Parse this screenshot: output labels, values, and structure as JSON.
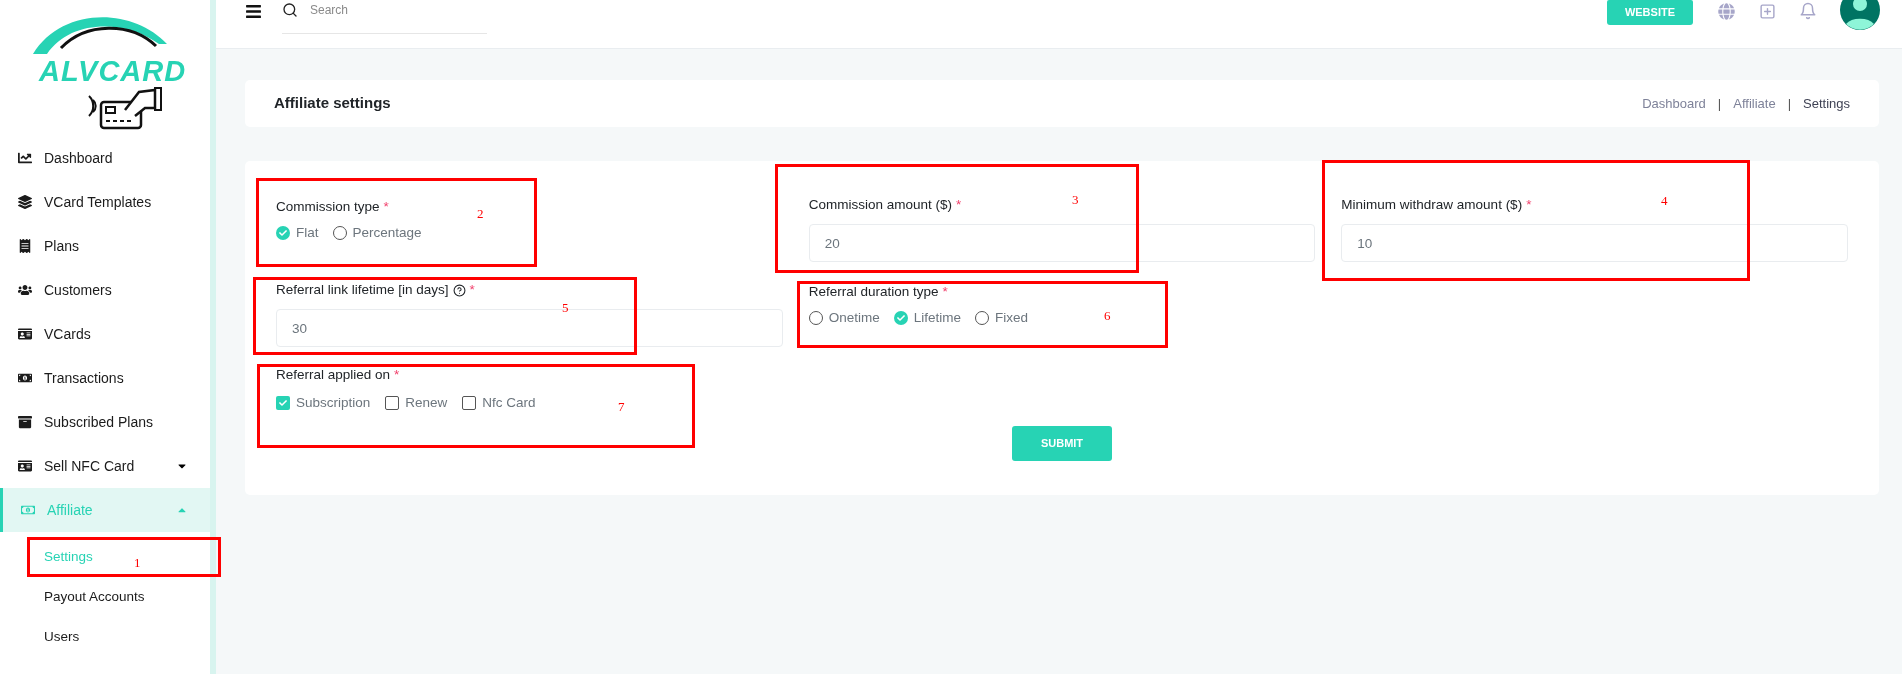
{
  "logo": {
    "text": "ALVCARD"
  },
  "sidebar": {
    "items": [
      {
        "label": "Dashboard",
        "selected": false
      },
      {
        "label": "VCard Templates",
        "selected": false
      },
      {
        "label": "Plans",
        "selected": false
      },
      {
        "label": "Customers",
        "selected": false
      },
      {
        "label": "VCards",
        "selected": false
      },
      {
        "label": "Transactions",
        "selected": false
      },
      {
        "label": "Subscribed Plans",
        "selected": false
      },
      {
        "label": "Sell NFC Card",
        "selected": false,
        "expanded": false
      },
      {
        "label": "Affiliate",
        "selected": true,
        "expanded": true,
        "children": [
          {
            "label": "Settings",
            "selected": true
          },
          {
            "label": "Payout Accounts",
            "selected": false
          },
          {
            "label": "Users",
            "selected": false
          }
        ]
      }
    ]
  },
  "topbar": {
    "search": {
      "placeholder": "Search"
    },
    "button": "WEBSITE"
  },
  "page_header": {
    "title": "Affiliate settings",
    "separator": "|",
    "breadcrumbs": [
      {
        "label": "Dashboard",
        "selected": false
      },
      {
        "label": "Affiliate",
        "selected": false
      },
      {
        "label": "Settings",
        "selected": true
      }
    ]
  },
  "form": {
    "fields": [
      {
        "kind": "radio",
        "label": "Commission type",
        "required": "*",
        "options": [
          {
            "label": "Flat",
            "selected": true
          },
          {
            "label": "Percentage",
            "selected": false
          }
        ]
      },
      {
        "kind": "input",
        "label": "Commission amount ($)",
        "required": "*",
        "value": "20"
      },
      {
        "kind": "input",
        "label": "Minimum withdraw amount ($)",
        "required": "*",
        "value": "10"
      },
      {
        "kind": "input",
        "label": "Referral link lifetime [in days]",
        "help": true,
        "required": "*",
        "value": "30"
      },
      {
        "kind": "radio",
        "label": "Referral duration type",
        "required": "*",
        "options": [
          {
            "label": "Onetime",
            "selected": false
          },
          {
            "label": "Lifetime",
            "selected": true
          },
          {
            "label": "Fixed",
            "selected": false
          }
        ]
      },
      {
        "kind": "empty"
      },
      {
        "kind": "checkbox",
        "label": "Referral applied on",
        "required": "*",
        "options": [
          {
            "label": "Subscription",
            "checked": true
          },
          {
            "label": "Renew",
            "checked": false
          },
          {
            "label": "Nfc Card",
            "checked": false
          }
        ]
      }
    ],
    "submit": "SUBMIT"
  },
  "annotations": [
    {
      "number": "1"
    },
    {
      "number": "2"
    },
    {
      "number": "3"
    },
    {
      "number": "4"
    },
    {
      "number": "5"
    },
    {
      "number": "6"
    },
    {
      "number": "7"
    }
  ]
}
